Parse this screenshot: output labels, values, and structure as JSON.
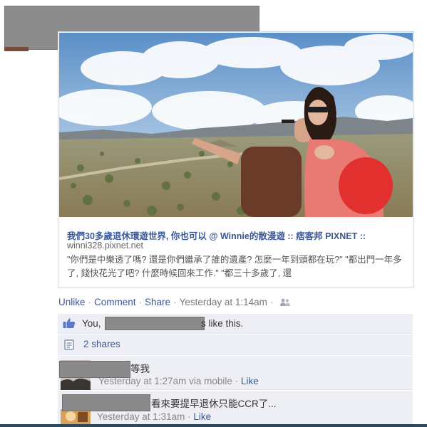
{
  "link": {
    "title": "我們30多歲退休環遊世界, 你也可以 @ Winnie的散漫遊 :: 痞客邦 PIXNET ::",
    "domain": "winni328.pixnet.net",
    "description": "\"你們是中樂透了嗎? 還是你們繼承了誰的遺產? 怎麼一年到頭都在玩?\" \"都出門一年多了, 錢快花光了吧? 什麼時候回來工作.\" \"都三十多歲了, 還"
  },
  "actions": {
    "unlike": "Unlike",
    "comment": "Comment",
    "share": "Share",
    "timestamp": "Yesterday at 1:14am",
    "separator": "·"
  },
  "likes": {
    "you": "You,",
    "tail": "s like this."
  },
  "shares": {
    "label": "2 shares"
  },
  "comments": [
    {
      "text": "等我",
      "timestamp": "Yesterday at 1:27am",
      "via": "via mobile",
      "like": "Like"
    },
    {
      "text": "看來要提早退休只能CCR了...",
      "timestamp": "Yesterday at 1:31am",
      "like": "Like"
    }
  ],
  "icons": {
    "audience": "friends-icon",
    "like": "like-thumb-icon",
    "share": "share-icon"
  },
  "colors": {
    "link_blue": "#3b5998",
    "ufi_background": "#edeff4",
    "redaction_gray": "#8a8a8a"
  }
}
